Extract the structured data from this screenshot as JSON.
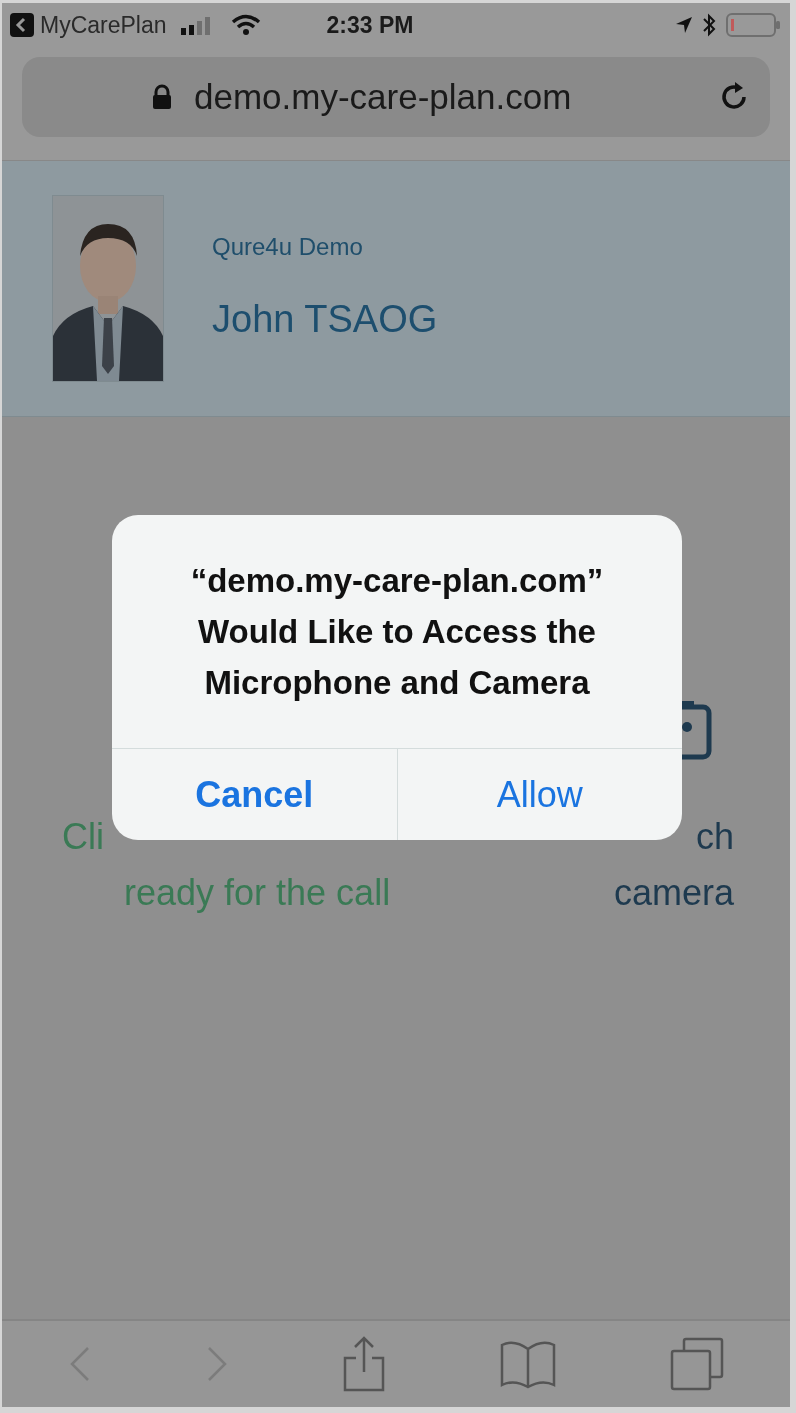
{
  "status_bar": {
    "back_app": "MyCarePlan",
    "time": "2:33 PM"
  },
  "address_bar": {
    "url": "demo.my-care-plan.com",
    "secure": true
  },
  "profile": {
    "organization": "Qure4u Demo",
    "name": "John TSAOG"
  },
  "content": {
    "left_lines": [
      "Cli",
      "ready for the call"
    ],
    "right_lines": [
      "ch",
      "camera"
    ]
  },
  "dialog": {
    "title": "“demo.my-care-plan.com” Would Like to Access the Microphone and Camera",
    "buttons": [
      {
        "label": "Cancel",
        "kind": "cancel"
      },
      {
        "label": "Allow",
        "kind": "default"
      }
    ]
  },
  "toolbar": {
    "back_enabled": false,
    "forward_enabled": false
  }
}
